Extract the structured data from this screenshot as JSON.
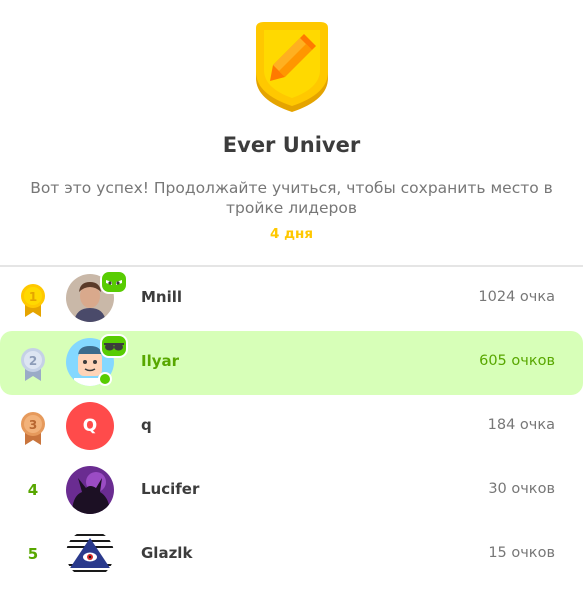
{
  "league": {
    "title": "Ever Univer",
    "message": "Вот это успех! Продолжайте учиться, чтобы сохранить место в тройке лидеров",
    "days_left": "4 дня"
  },
  "leaderboard": [
    {
      "rank": "1",
      "name": "Mnill",
      "points": "1024 очка",
      "medal": "gold",
      "current": false
    },
    {
      "rank": "2",
      "name": "Ilyar",
      "points": "605 очков",
      "medal": "silver",
      "current": true
    },
    {
      "rank": "3",
      "name": "q",
      "avatar_letter": "Q",
      "points": "184 очка",
      "medal": "bronze",
      "current": false
    },
    {
      "rank": "4",
      "name": "Lucifer",
      "points": "30 очков",
      "current": false
    },
    {
      "rank": "5",
      "name": "Glazlk",
      "points": "15 очков",
      "current": false
    }
  ],
  "colors": {
    "accent_green": "#58a700",
    "highlight_row": "#d7ffb8",
    "gold": "#ffc800",
    "divider": "#e5e5e5"
  },
  "icons": {
    "league_badge": "pencil-shield-icon",
    "friend_badge": "owl-face-icon",
    "medals": [
      "gold-medal-icon",
      "silver-medal-icon",
      "bronze-medal-icon"
    ]
  }
}
